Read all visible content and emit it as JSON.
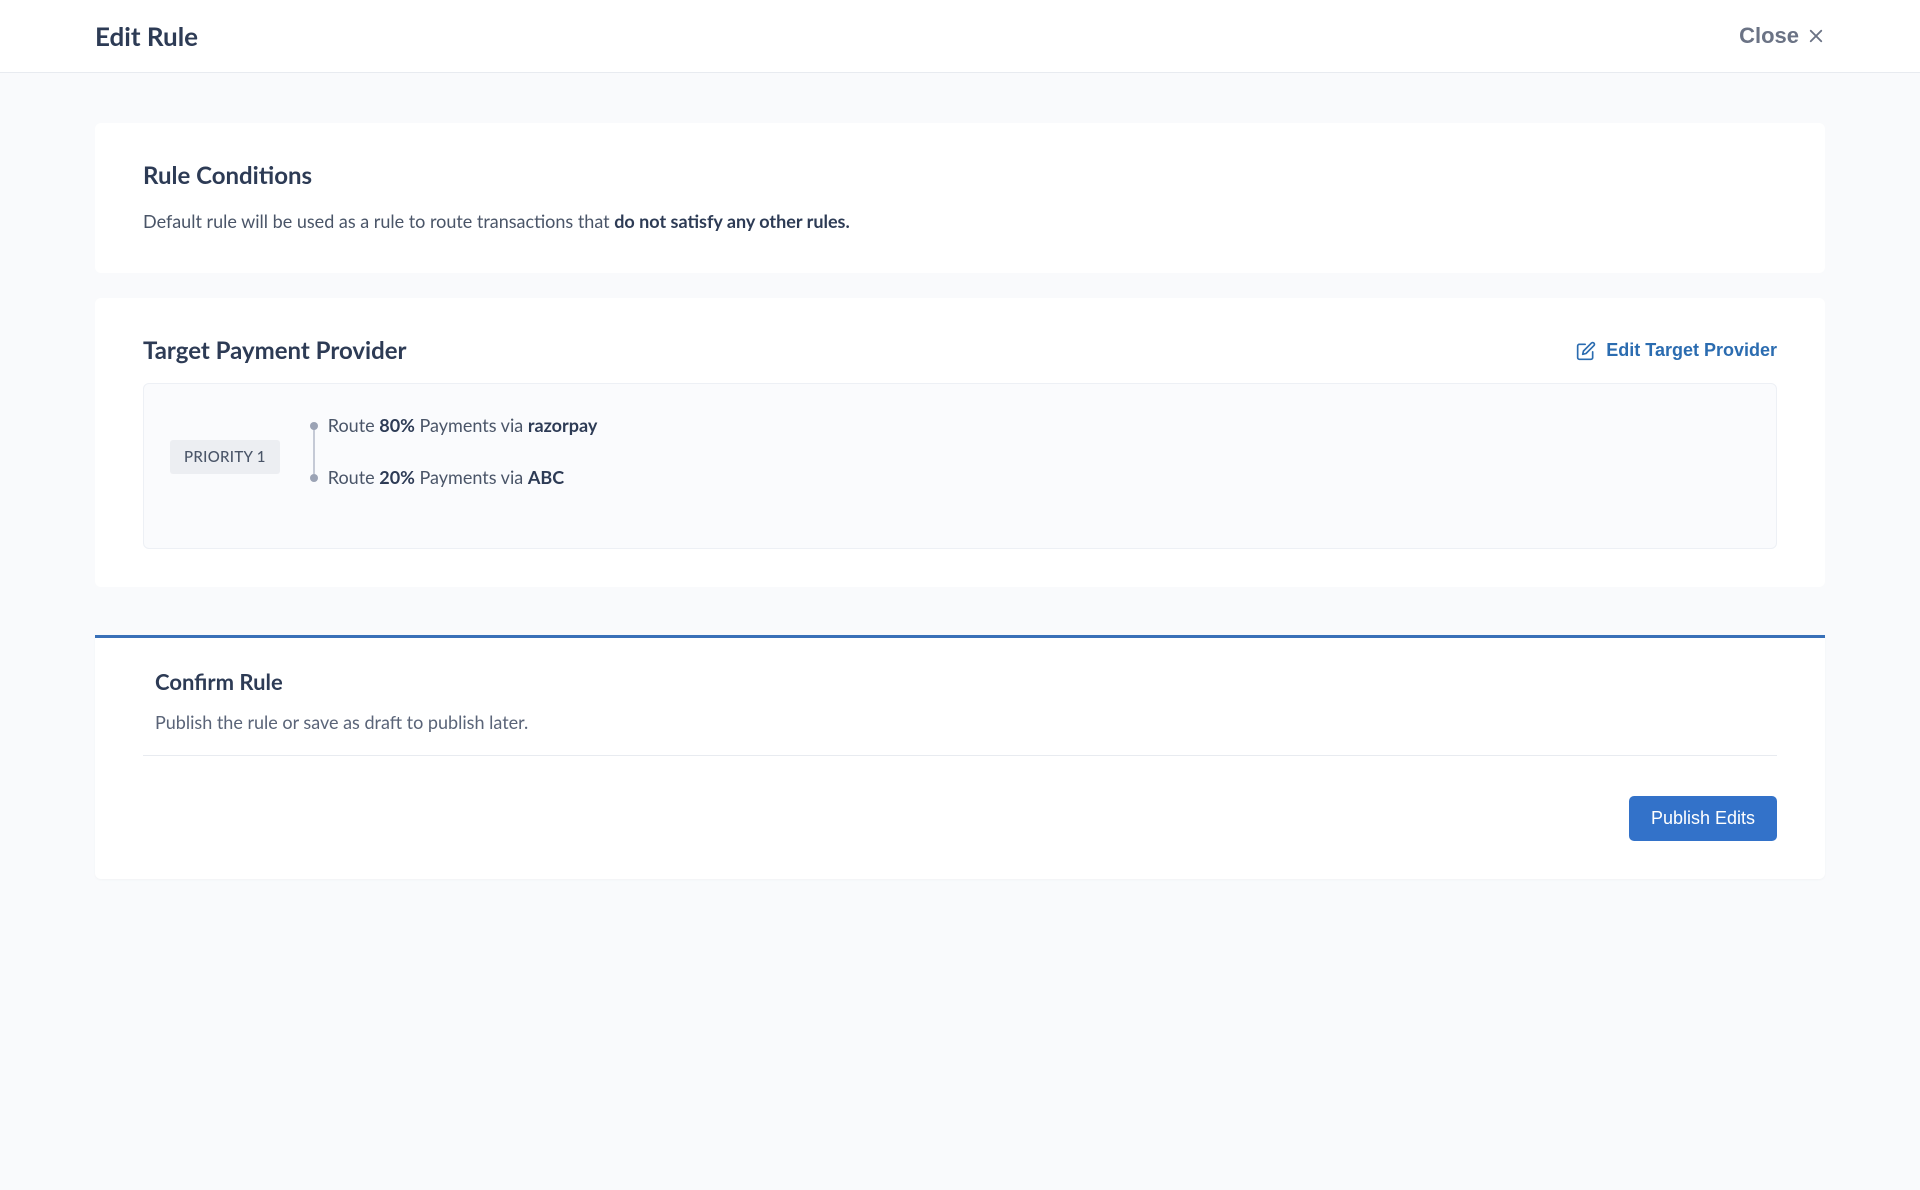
{
  "header": {
    "title": "Edit Rule",
    "close_label": "Close"
  },
  "rule_conditions": {
    "title": "Rule Conditions",
    "subtext_prefix": "Default rule will be used as a rule to route transactions that ",
    "subtext_strong": "do not satisfy any other rules."
  },
  "target_provider": {
    "title": "Target Payment Provider",
    "edit_label": "Edit Target Provider",
    "priority_label": "PRIORITY 1",
    "routes": [
      {
        "prefix": "Route ",
        "percent": "80%",
        "middle": " Payments via ",
        "provider": "razorpay"
      },
      {
        "prefix": "Route ",
        "percent": "20%",
        "middle": " Payments via ",
        "provider": "ABC"
      }
    ]
  },
  "confirm": {
    "title": "Confirm Rule",
    "subtext": "Publish the rule or save as draft to publish later.",
    "publish_label": "Publish Edits"
  }
}
